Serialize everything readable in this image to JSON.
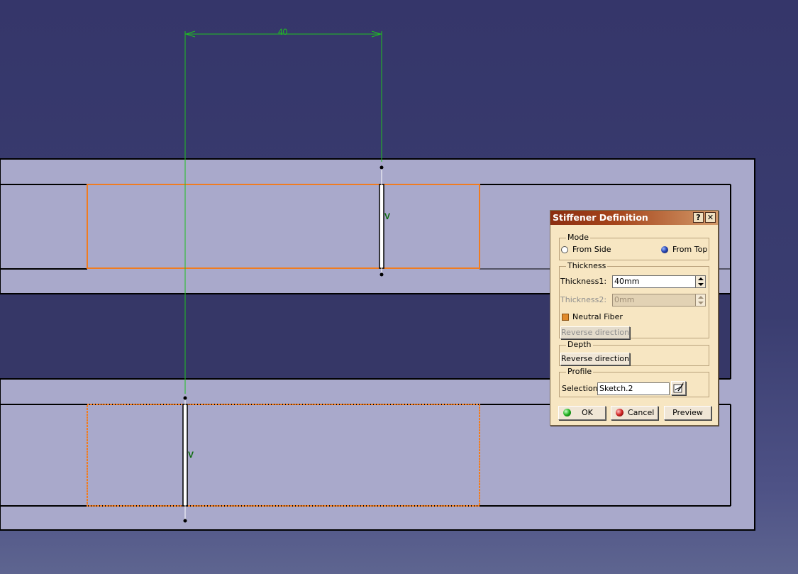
{
  "viewport": {
    "dimension_value": "40",
    "stiffener_marker": "V",
    "colors": {
      "background": "#363767",
      "part_fill": "#a9a9cb",
      "profile_highlight": "#f07c20",
      "dimension_line": "#20c020"
    }
  },
  "dialog": {
    "title": "Stiffener Definition",
    "help_button": "?",
    "close_button": "✕",
    "mode": {
      "label": "Mode",
      "options": [
        "From Side",
        "From Top"
      ],
      "selected": "From Top"
    },
    "thickness": {
      "label": "Thickness",
      "thickness1_label": "Thickness1:",
      "thickness1_value": "40mm",
      "thickness2_label": "Thickness2:",
      "thickness2_value": "0mm",
      "neutral_fiber_label": "Neutral Fiber",
      "neutral_fiber_checked": true,
      "reverse_direction_label": "Reverse direction"
    },
    "depth": {
      "label": "Depth",
      "reverse_direction_label": "Reverse direction"
    },
    "profile": {
      "label": "Profile",
      "selection_label": "Selection:",
      "selection_value": "Sketch.2",
      "sketch_icon": "sketcher-icon"
    },
    "buttons": {
      "ok": "OK",
      "cancel": "Cancel",
      "preview": "Preview"
    }
  }
}
